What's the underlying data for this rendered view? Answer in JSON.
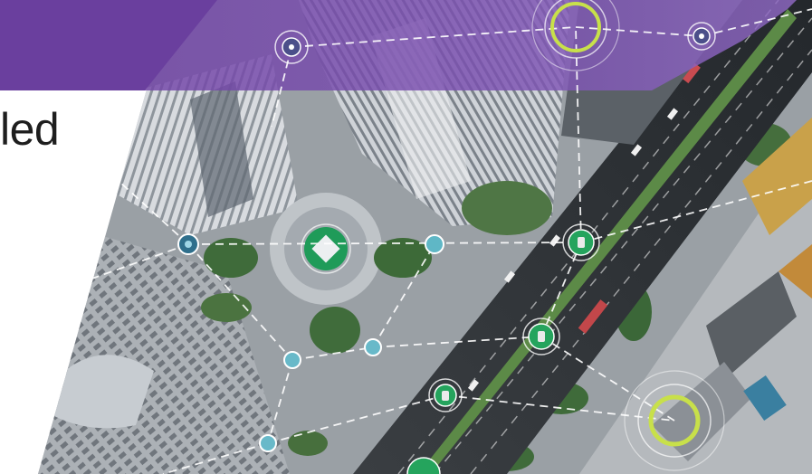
{
  "headline": {
    "text": "led"
  },
  "colors": {
    "banner_purple": "#6a3f9e",
    "banner_purple_light": "#8c64bf",
    "node_green": "#25a45d",
    "node_teal": "#5fb7c6",
    "lime_ring": "#c8e04a",
    "asphalt": "#2c3034",
    "building": "#d5d8dc"
  },
  "icons": {
    "vehicle_node": "car-node-icon",
    "drone_node": "drone-node-icon",
    "sensor_node": "sensor-node-icon",
    "target_ring": "target-ring-icon"
  }
}
